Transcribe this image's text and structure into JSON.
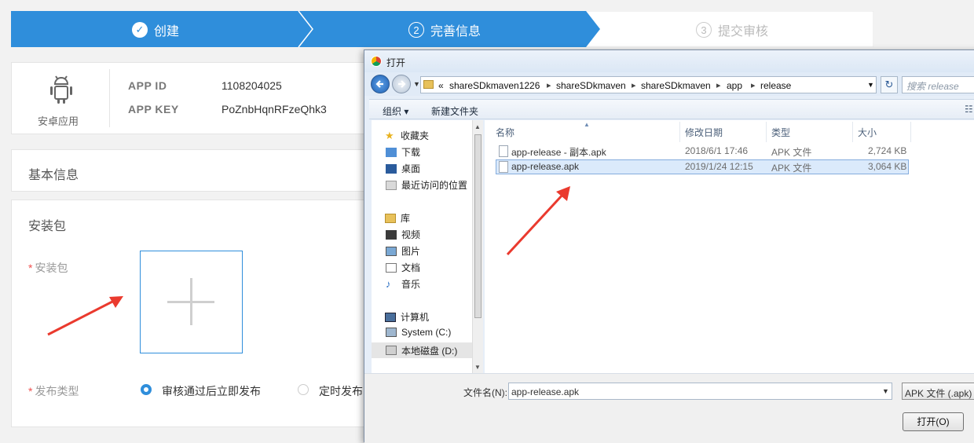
{
  "stepper": {
    "steps": [
      {
        "label": "创建",
        "marker": "✓",
        "state": "done"
      },
      {
        "label": "完善信息",
        "marker": "2",
        "state": "active"
      },
      {
        "label": "提交审核",
        "marker": "3",
        "state": "pending"
      }
    ],
    "colors": {
      "active": "#2f8edb",
      "pending_text": "#bbbbbb"
    }
  },
  "app_card": {
    "platform_icon": "android-icon",
    "platform_label": "安卓应用",
    "app_id_label": "APP ID",
    "app_id_value": "1108204025",
    "app_key_label": "APP KEY",
    "app_key_value": "PoZnbHqnRFzeQhk3"
  },
  "basic_info": {
    "title": "基本信息"
  },
  "package_section": {
    "title": "安装包",
    "package_label": "安装包",
    "upload_icon": "plus-icon",
    "publish_type_label": "发布类型",
    "publish_options": [
      {
        "label": "审核通过后立即发布",
        "selected": true
      },
      {
        "label": "定时发布",
        "selected": false
      }
    ]
  },
  "dialog": {
    "title": "打开",
    "path": [
      "shareSDkmaven1226",
      "shareSDkmaven",
      "shareSDkmaven",
      "app",
      "release"
    ],
    "path_overflow": "«",
    "search_placeholder": "搜索 release",
    "toolbar": {
      "organize": "组织 ▾",
      "new_folder": "新建文件夹"
    },
    "nav": {
      "favorites": {
        "label": "收藏夹",
        "items": [
          "下载",
          "桌面",
          "最近访问的位置"
        ]
      },
      "libraries": {
        "label": "库",
        "items": [
          "视频",
          "图片",
          "文档",
          "音乐"
        ]
      },
      "computer": {
        "label": "计算机",
        "items": [
          "System (C:)",
          "本地磁盘 (D:)"
        ]
      }
    },
    "columns": {
      "name": "名称",
      "modified": "修改日期",
      "type": "类型",
      "size": "大小"
    },
    "files": [
      {
        "name": "app-release - 副本.apk",
        "modified": "2018/6/1 17:46",
        "type": "APK 文件",
        "size": "2,724 KB",
        "selected": false
      },
      {
        "name": "app-release.apk",
        "modified": "2019/1/24 12:15",
        "type": "APK 文件",
        "size": "3,064 KB",
        "selected": true
      }
    ],
    "filename_label": "文件名(N):",
    "filename_value": "app-release.apk",
    "filter_value": "APK 文件 (.apk) (",
    "open_button": "打开(O)"
  }
}
